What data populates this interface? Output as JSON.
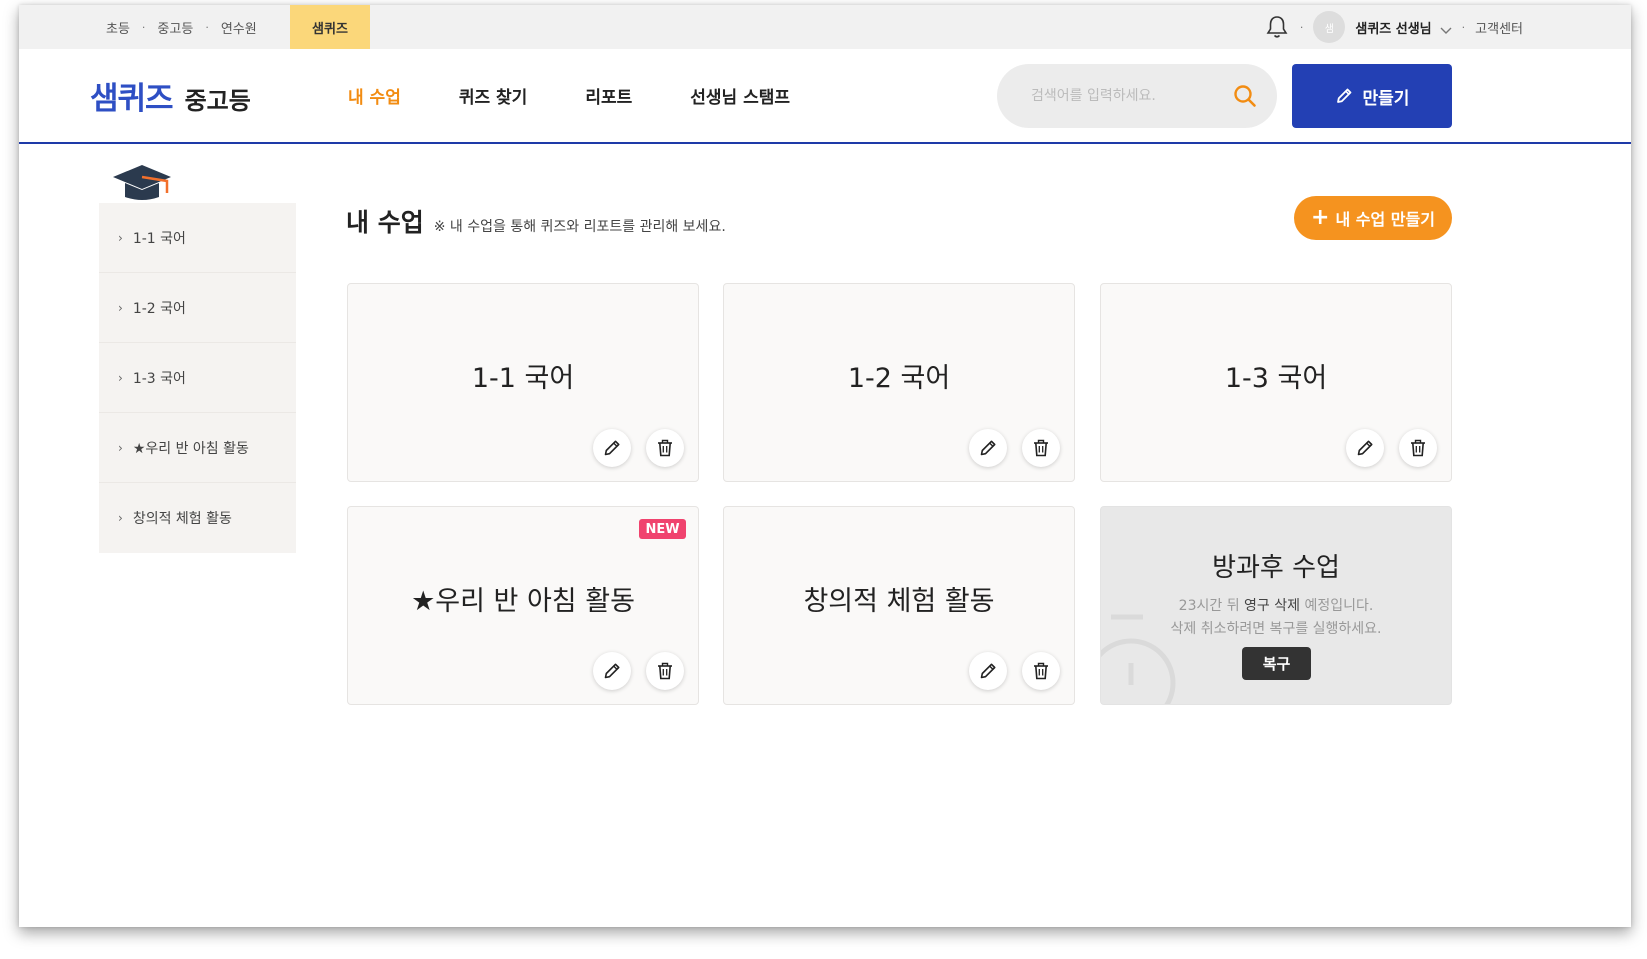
{
  "utilbar": {
    "links": [
      "초등",
      "중고등",
      "연수원"
    ],
    "active_site": "샘퀴즈",
    "avatar_text": "샘",
    "user_name": "샘퀴즈 선생님",
    "support": "고객센터"
  },
  "header": {
    "logo_main": "샘퀴즈",
    "logo_sub": "중고등",
    "nav": [
      "내 수업",
      "퀴즈 찾기",
      "리포트",
      "선생님 스탬프"
    ],
    "active_nav": "내 수업",
    "search_placeholder": "검색어를 입력하세요.",
    "make_label": "만들기"
  },
  "sidebar": {
    "items": [
      "1-1 국어",
      "1-2 국어",
      "1-3 국어",
      "★우리 반 아침 활동",
      "창의적 체험 활동"
    ]
  },
  "main": {
    "title": "내 수업",
    "note": "※ 내 수업을 통해 퀴즈와 리포트를 관리해 보세요.",
    "add_button": "내 수업 만들기",
    "cards": [
      {
        "title": "1-1 국어"
      },
      {
        "title": "1-2 국어"
      },
      {
        "title": "1-3 국어"
      },
      {
        "title": "★우리 반 아침 활동",
        "badge": "NEW"
      },
      {
        "title": "창의적 체험 활동"
      }
    ],
    "deleted_card": {
      "title": "방과후 수업",
      "line1_a": "23시간 뒤 ",
      "line1_b": "영구 삭제",
      "line1_c": " 예정입니다.",
      "line2": "삭제 취소하려면 복구를 실행하세요.",
      "restore": "복구"
    }
  },
  "colors": {
    "brand_blue": "#2340b4",
    "accent_orange": "#f5931f",
    "active_nav": "#f28c12",
    "util_active_bg": "#fbd77a",
    "new_badge": "#f0436e"
  },
  "icons": [
    "bell-icon",
    "chevron-down-icon",
    "search-icon",
    "pencil-icon",
    "trash-icon",
    "graduation-cap-icon"
  ]
}
